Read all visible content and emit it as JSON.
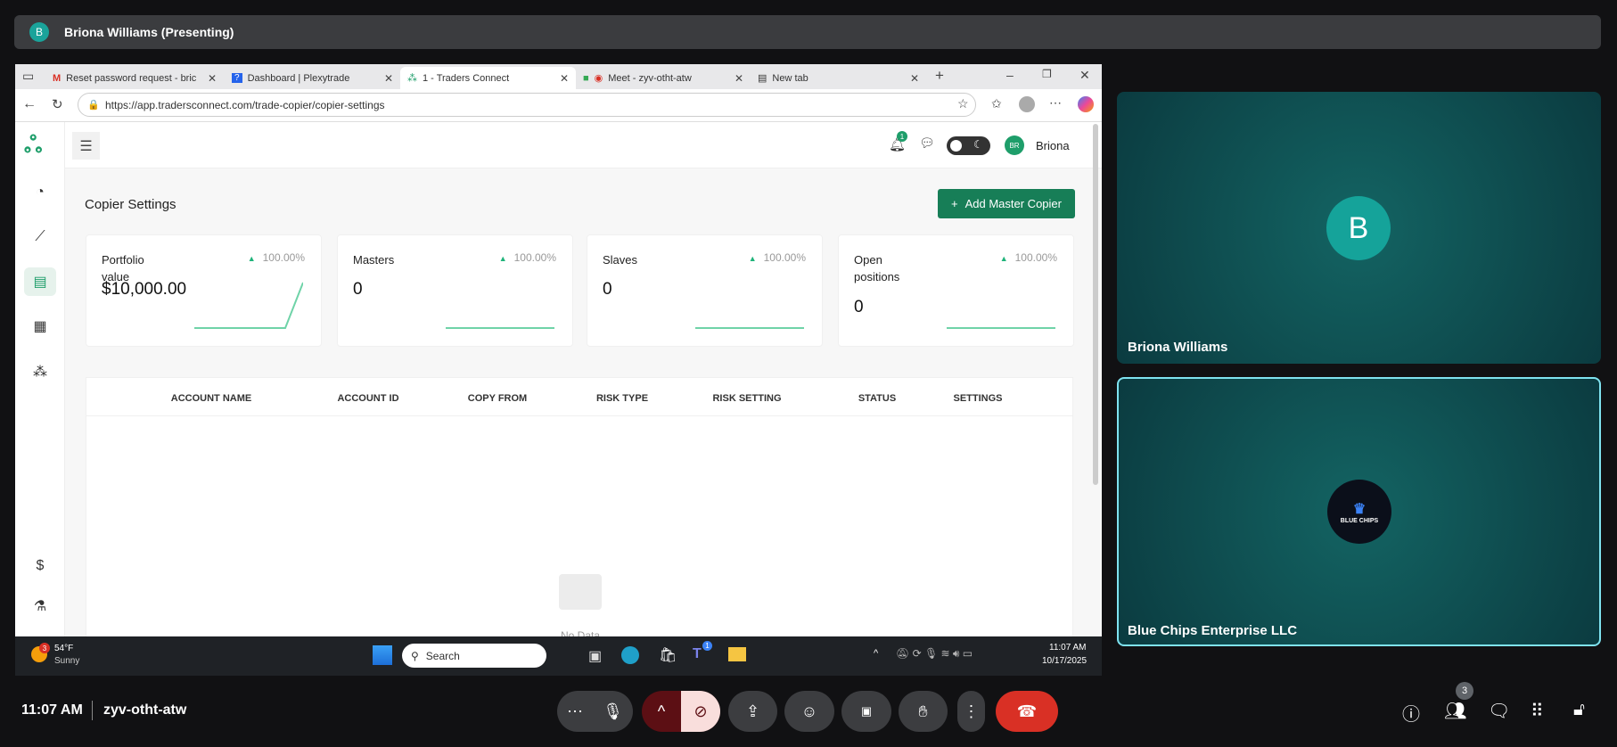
{
  "meeting": {
    "presenter_initial": "B",
    "presenter_label": "Briona Williams (Presenting)",
    "time": "11:07 AM",
    "code": "zyv-otht-atw",
    "participant_count": "3"
  },
  "browser": {
    "tabs": [
      {
        "label": "Reset password request - bric"
      },
      {
        "label": "Dashboard | Plexytrade"
      },
      {
        "label": "1 - Traders Connect",
        "active": true
      },
      {
        "label": "Meet - zyv-otht-atw"
      },
      {
        "label": "New tab"
      }
    ],
    "url": "https://app.tradersconnect.com/trade-copier/copier-settings"
  },
  "app": {
    "notification_count": "1",
    "user_initials": "BR",
    "user_name": "Briona",
    "page_title": "Copier Settings",
    "add_button": "Add Master Copier",
    "cards": [
      {
        "label": "Portfolio value",
        "change": "100.00%",
        "value": "$10,000.00"
      },
      {
        "label": "Masters",
        "change": "100.00%",
        "value": "0"
      },
      {
        "label": "Slaves",
        "change": "100.00%",
        "value": "0"
      },
      {
        "label": "Open positions",
        "change": "100.00%",
        "value": "0"
      }
    ],
    "columns": [
      "ACCOUNT NAME",
      "ACCOUNT ID",
      "COPY FROM",
      "RISK TYPE",
      "RISK SETTING",
      "STATUS",
      "SETTINGS"
    ],
    "empty_text": "No Data"
  },
  "taskbar": {
    "weather_temp": "54°F",
    "weather_desc": "Sunny",
    "weather_badge": "3",
    "search_placeholder": "Search",
    "teams_badge": "1",
    "clock_time": "11:07 AM",
    "clock_date": "10/17/2025"
  },
  "tiles": [
    {
      "initial": "B",
      "name": "Briona Williams"
    },
    {
      "logo_text": "BLUE CHIPS",
      "name": "Blue Chips Enterprise LLC"
    }
  ],
  "colors": {
    "brand": "#1e9e6a",
    "button": "#177e57",
    "end_call": "#d93025",
    "tile_border": "#7fe3f0"
  }
}
